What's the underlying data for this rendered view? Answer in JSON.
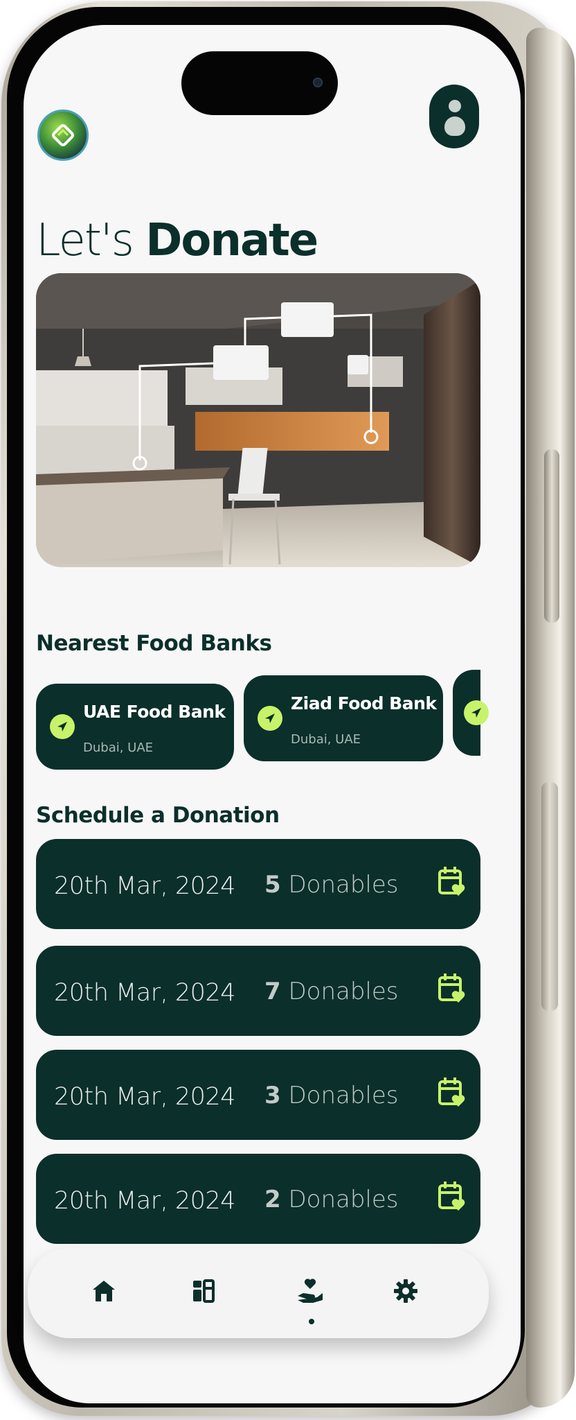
{
  "header": {
    "logo_icon": "recycle-knot-logo-icon",
    "avatar_icon": "user-avatar-icon"
  },
  "title": {
    "light": "Let's",
    "bold": "Donate"
  },
  "hero": {
    "image": "kitchen-smart-devices-illustration"
  },
  "food_banks": {
    "heading": "Nearest Food Banks",
    "items": [
      {
        "name": "UAE Food Bank",
        "location": "Dubai, UAE"
      },
      {
        "name": "Ziad Food Bank",
        "location": "Dubai, UAE"
      },
      {
        "name": "",
        "location": ""
      }
    ]
  },
  "schedule": {
    "heading": "Schedule a Donation",
    "items": [
      {
        "date": "20th Mar, 2024",
        "count": "5",
        "unit": "Donables"
      },
      {
        "date": "20th Mar, 2024",
        "count": "7",
        "unit": "Donables"
      },
      {
        "date": "20th Mar, 2024",
        "count": "3",
        "unit": "Donables"
      },
      {
        "date": "20th Mar, 2024",
        "count": "2",
        "unit": "Donables"
      }
    ]
  },
  "nav": {
    "items": [
      {
        "icon": "home-icon"
      },
      {
        "icon": "dashboard-icon"
      },
      {
        "icon": "donate-hand-icon",
        "active": true
      },
      {
        "icon": "gear-icon"
      }
    ]
  },
  "colors": {
    "primary": "#0b2f2b",
    "accent": "#c7f36a",
    "background": "#f7f7f7"
  }
}
